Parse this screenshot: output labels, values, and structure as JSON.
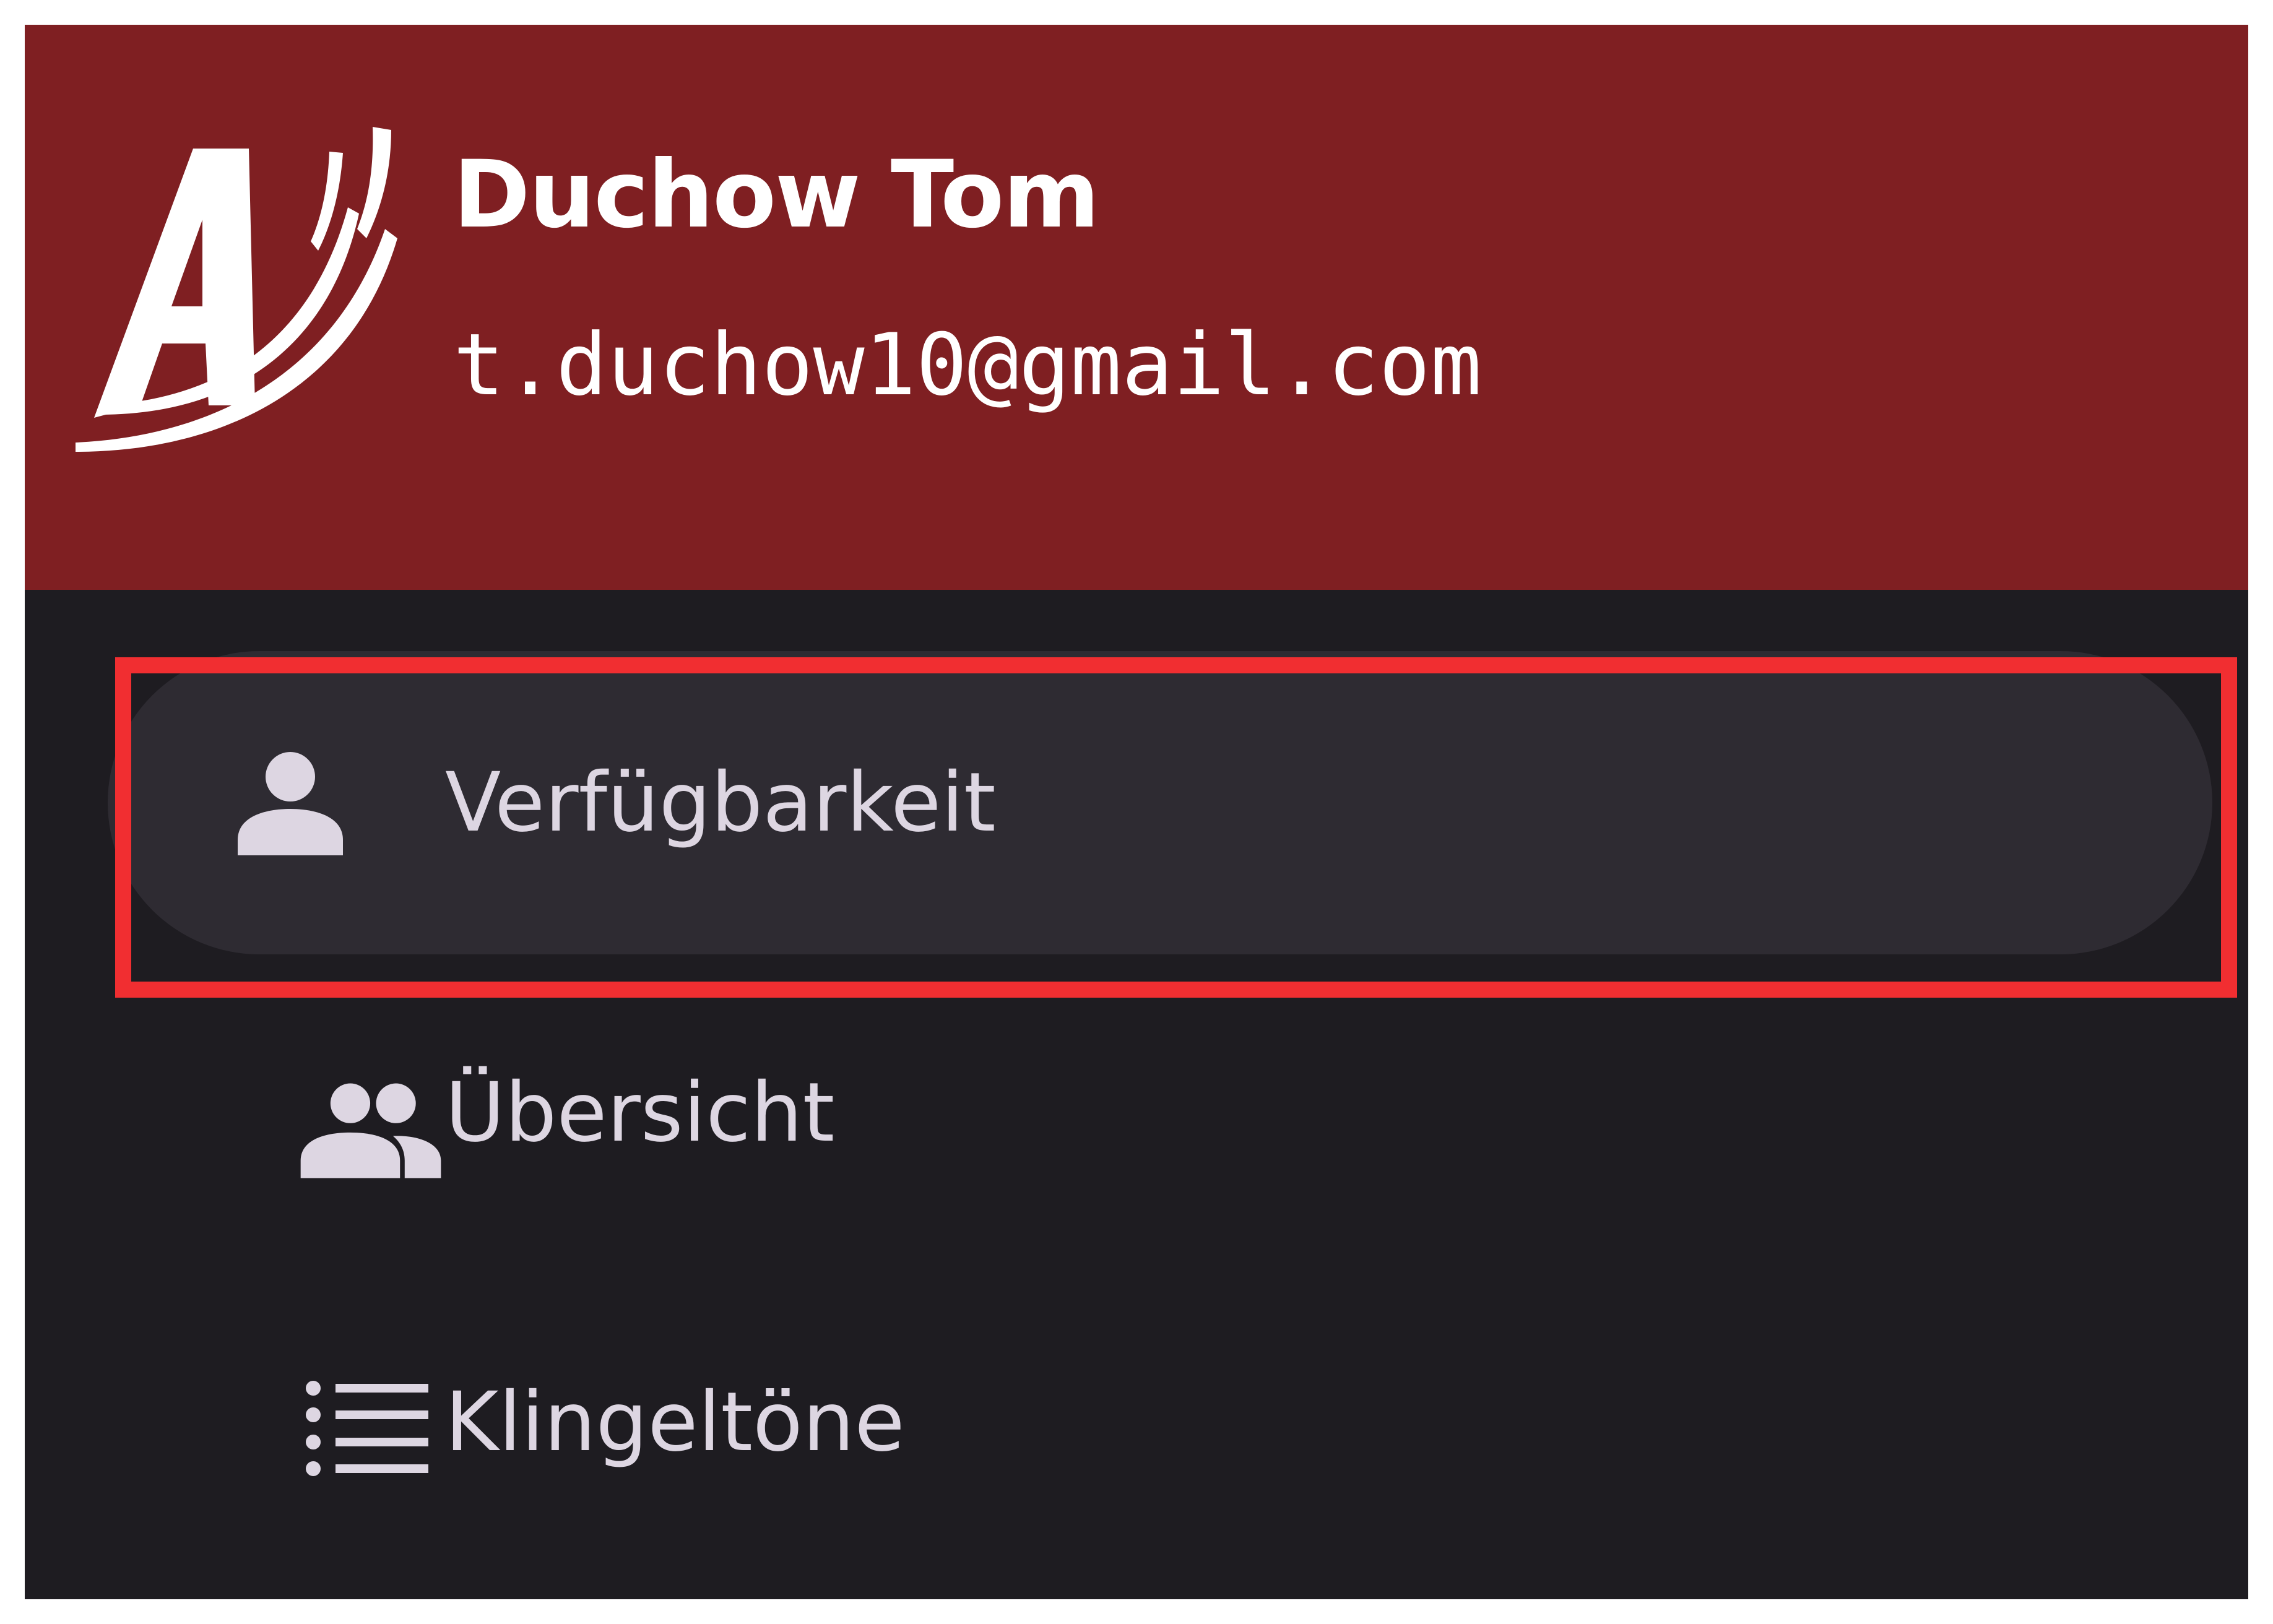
{
  "header": {
    "user_name": "Duchow Tom",
    "user_email": "t.duchow10@gmail.com",
    "logo_icon": "app-logo-a"
  },
  "menu": {
    "items": [
      {
        "label": "Verfügbarkeit",
        "icon": "person-icon",
        "selected": true
      },
      {
        "label": "Übersicht",
        "icon": "group-icon",
        "selected": false
      },
      {
        "label": "Klingeltöne",
        "icon": "list-icon",
        "selected": false
      }
    ]
  },
  "colors": {
    "header_bg": "#7f1f22",
    "drawer_bg": "#1e1c21",
    "selected_item_bg": "#2e2b32",
    "item_text": "#ddd6e2",
    "highlight_border": "#f12e31"
  }
}
